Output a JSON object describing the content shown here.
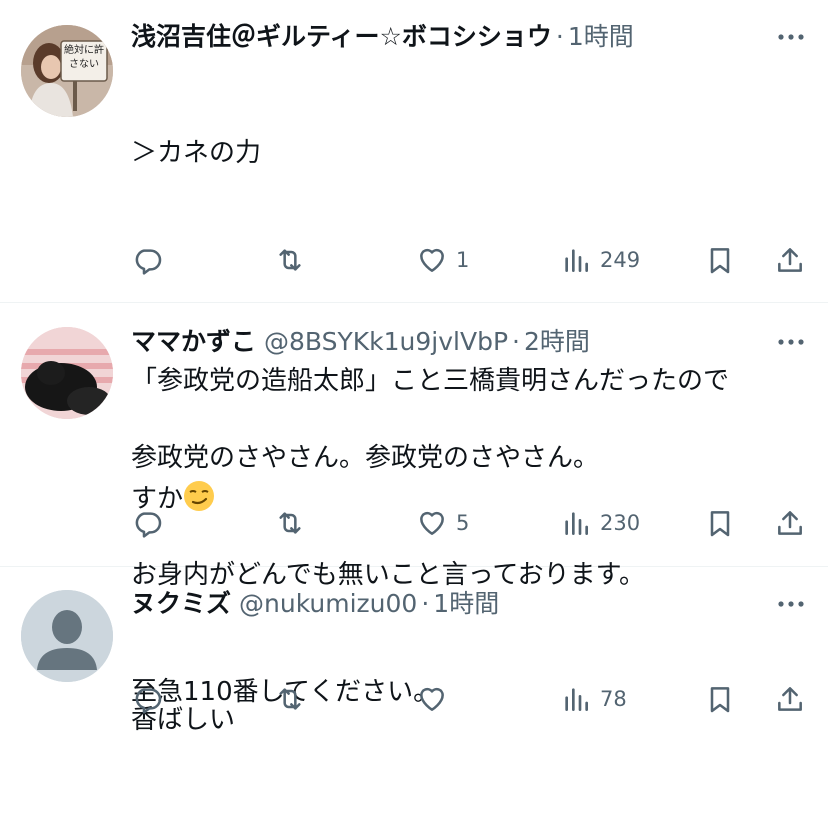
{
  "colors": {
    "text": "#0f1419",
    "secondary": "#536471",
    "divider": "#eff3f4"
  },
  "tweets": [
    {
      "display_name": "浅沼吉住＠ギルティー☆ボコシショウ",
      "handle": "",
      "time": "1時間",
      "lines": [
        "＞カネの力",
        "",
        "「参政党の造船太郎」こと三橋貴明さんだったので",
        "すか"
      ],
      "emoji": "smirking-face",
      "avatar_sign_text": "絶対に許さない",
      "reply_count": "",
      "retweet_count": "",
      "like_count": "1",
      "view_count": "249"
    },
    {
      "display_name": "ママかずこ",
      "handle": "@8BSYKk1u9jvlVbP",
      "time": "2時間",
      "lines": [
        "参政党のさやさん。参政党のさやさん。",
        "お身内がどんでも無いこと言っております。",
        "至急110番してください。"
      ],
      "reply_count": "",
      "retweet_count": "",
      "like_count": "5",
      "view_count": "230"
    },
    {
      "display_name": "ヌクミズ",
      "handle": "@nukumizu00",
      "time": "1時間",
      "lines": [
        "香ばしい"
      ],
      "reply_count": "",
      "retweet_count": "",
      "like_count": "",
      "view_count": "78"
    }
  ]
}
